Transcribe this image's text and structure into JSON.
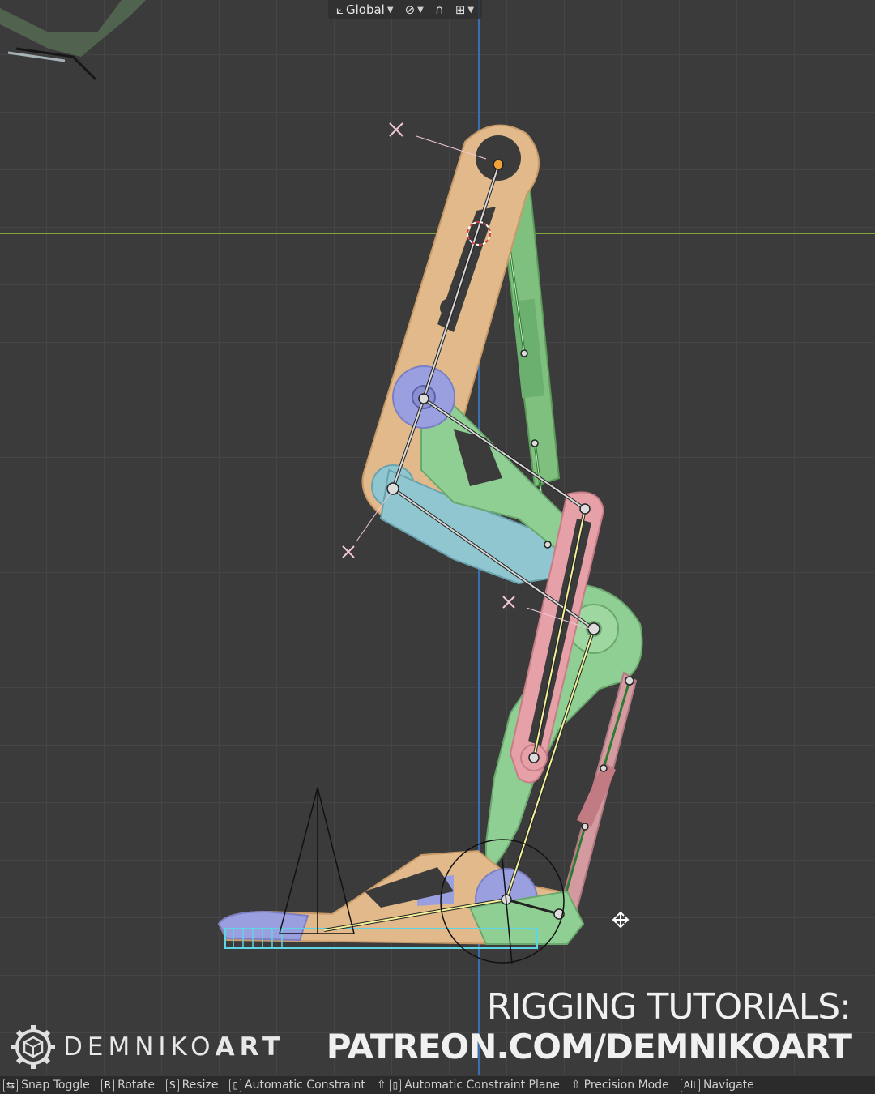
{
  "header": {
    "orientation_icon": "transform-orientation-icon",
    "orientation": "Global",
    "pivot_icon": "pivot-point-icon",
    "snap_icon": "snap-magnet-icon",
    "snap_target_icon": "snap-increment-icon"
  },
  "branding": {
    "logo_icon": "gear-logo-icon",
    "name_light": "DEMNIKO",
    "name_bold": "ART"
  },
  "promo": {
    "line1": "RIGGING TUTORIALS:",
    "line2": "PATREON.COM/DEMNIKOART"
  },
  "status_bar": {
    "items": [
      {
        "key": "",
        "label": "Snap Toggle"
      },
      {
        "key": "R",
        "label": "Rotate"
      },
      {
        "key": "S",
        "label": "Resize"
      },
      {
        "key": "",
        "label": "Automatic Constraint"
      },
      {
        "key": "",
        "label": "Automatic Constraint Plane"
      },
      {
        "key": "",
        "label": "Precision Mode"
      },
      {
        "key": "Alt",
        "label": "Navigate"
      }
    ]
  },
  "colors": {
    "thigh": "#e2b98a",
    "green_parts": "#8fcf93",
    "blue_parts": "#8fc6cf",
    "pink_parts": "#e6a1a8",
    "purple_discs": "#9a9fe0",
    "x_axis": "#7ea83a",
    "y_axis": "#3a6fb0"
  }
}
